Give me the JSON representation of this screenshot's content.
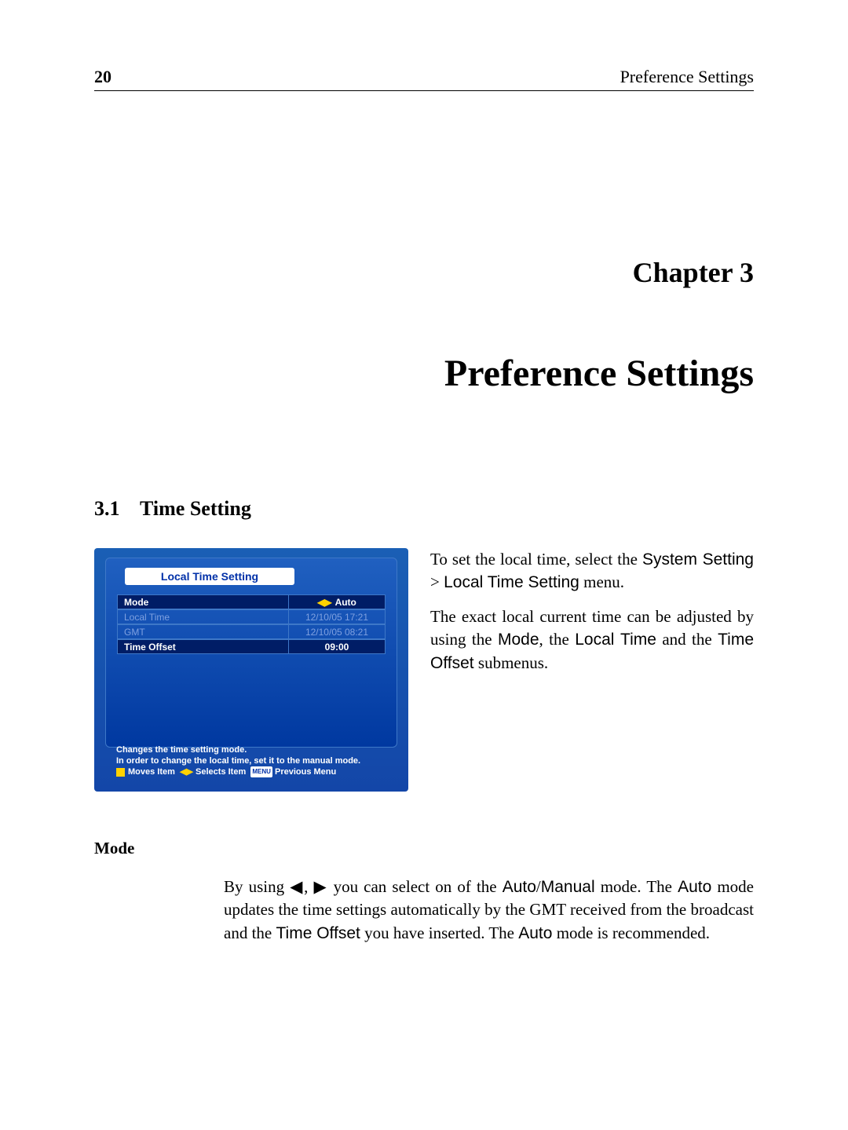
{
  "header": {
    "page_number": "20",
    "running_title": "Preference Settings"
  },
  "chapter": {
    "label": "Chapter 3",
    "title": "Preference Settings"
  },
  "section": {
    "number": "3.1",
    "title": "Time Setting"
  },
  "screenshot": {
    "panel_title": "Local Time Setting",
    "rows": [
      {
        "label": "Mode",
        "value": "Auto",
        "selected": true,
        "arrows": true
      },
      {
        "label": "Local Time",
        "value": "12/10/05 17:21",
        "dim": true
      },
      {
        "label": "GMT",
        "value": "12/10/05 08:21",
        "dim": true
      },
      {
        "label": "Time Offset",
        "value": "09:00",
        "selected": true
      }
    ],
    "help_line1": "Changes the time setting mode.",
    "help_line2": "In order to change the local time, set it to the manual mode.",
    "moves_label": "Moves Item",
    "selects_label": "Selects Item",
    "menu_badge": "MENU",
    "previous_label": "Previous Menu"
  },
  "para1_a": "To set the local time, select the ",
  "para1_b": "System Setting",
  "para1_c": " > ",
  "para1_d": "Local Time Setting",
  "para1_e": " menu.",
  "para2_a": "The exact local current time can be adjusted by using the ",
  "para2_b": "Mode",
  "para2_c": ", the ",
  "para2_d": "Local Time",
  "para2_e": " and the ",
  "para2_f": "Time Offset",
  "para2_g": " submenus.",
  "subhead": "Mode",
  "mode_a": "By using ",
  "mode_left": "◀",
  "mode_sep": ", ",
  "mode_right": "▶",
  "mode_b": " you can select on of the ",
  "mode_c": "Auto",
  "mode_d": "/",
  "mode_e": "Manual",
  "mode_f": " mode. The ",
  "mode_g": "Auto",
  "mode_h": " mode updates the time settings automatically by the GMT received from the broadcast and the ",
  "mode_i": "Time Offset",
  "mode_j": " you have inserted. The ",
  "mode_k": "Auto",
  "mode_l": " mode is recommended."
}
